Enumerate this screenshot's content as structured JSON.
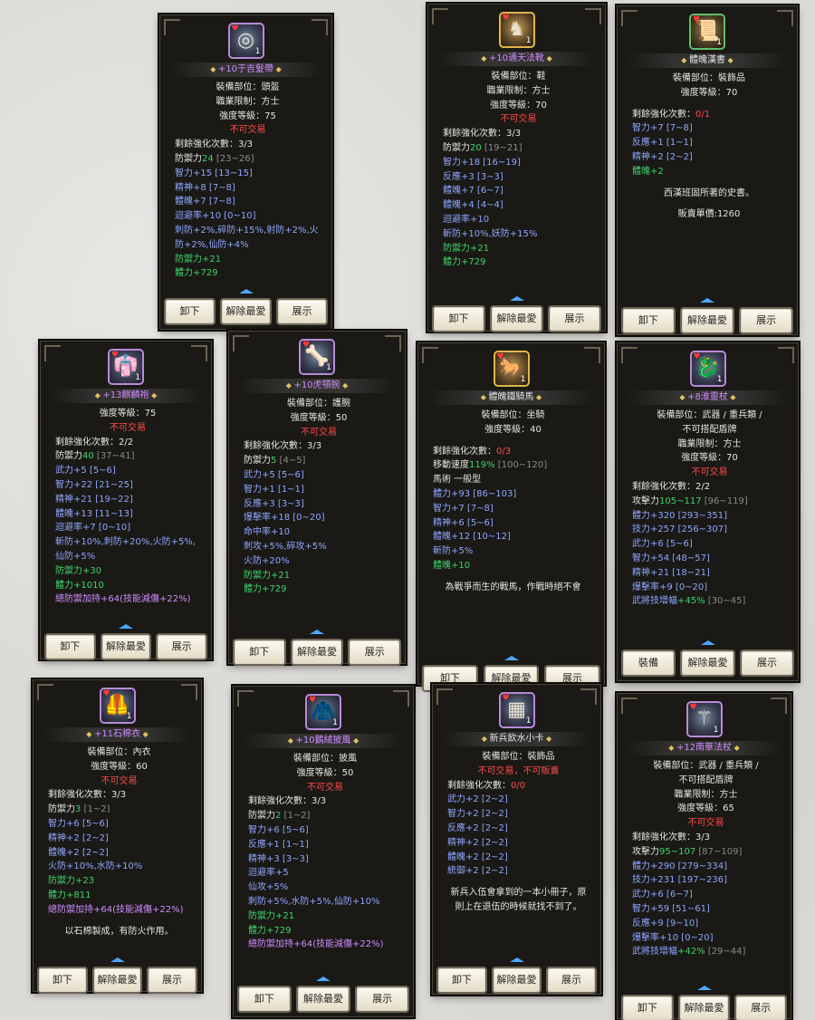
{
  "labels": {
    "slot": "裝備部位：",
    "job": "職業限制：",
    "level": "強度等級："
  },
  "cards": [
    {
      "name": "+10于吉髮帶",
      "name_color": "#d08cff",
      "icon": "head-band-icon",
      "glyph": "◎",
      "lines": [
        {
          "t": "裝備部位：頭盔",
          "c": "wht",
          "a": "c"
        },
        {
          "t": "職業限制：方士",
          "c": "wht",
          "a": "c"
        },
        {
          "t": "強度等級：75",
          "c": "wht",
          "a": "c"
        },
        {
          "t": "不可交易",
          "c": "red",
          "a": "c"
        },
        {
          "t": "剩餘強化次數：3/3",
          "c": "wht"
        },
        {
          "t": "防禦力",
          "v": "24",
          "r": " [23~26]",
          "c": "wht",
          "vc": "grn"
        },
        {
          "t": "智力+15 [13~15]",
          "c": "blu"
        },
        {
          "t": "精神+8 [7~8]",
          "c": "blu"
        },
        {
          "t": "體魄+7 [7~8]",
          "c": "blu"
        },
        {
          "t": "迴避率+10 [0~10]",
          "c": "blu"
        },
        {
          "t": "刺防+2%,碎防+15%,射防+2%,火防+2%,仙防+4%",
          "c": "blu"
        },
        {
          "t": "防禦力+21",
          "c": "grn"
        },
        {
          "t": "體力+729",
          "c": "grn"
        }
      ],
      "buttons": [
        "卸下",
        "解除最愛",
        "展示"
      ]
    },
    {
      "name": "+10通天法靴",
      "name_color": "#d08cff",
      "icon": "boots-icon",
      "glyph": "♞",
      "icls": "gold",
      "lines": [
        {
          "t": "裝備部位：鞋",
          "c": "wht",
          "a": "c"
        },
        {
          "t": "職業限制：方士",
          "c": "wht",
          "a": "c"
        },
        {
          "t": "強度等級：70",
          "c": "wht",
          "a": "c"
        },
        {
          "t": "不可交易",
          "c": "red",
          "a": "c"
        },
        {
          "t": "剩餘強化次數：3/3",
          "c": "wht"
        },
        {
          "t": "防禦力",
          "v": "20",
          "r": " [19~21]",
          "c": "wht",
          "vc": "grn"
        },
        {
          "t": "智力+18 [16~19]",
          "c": "blu"
        },
        {
          "t": "反應+3 [3~3]",
          "c": "blu"
        },
        {
          "t": "體魄+7 [6~7]",
          "c": "blu"
        },
        {
          "t": "體魄+4 [4~4]",
          "c": "blu"
        },
        {
          "t": "迴避率+10",
          "c": "blu"
        },
        {
          "t": "斬防+10%,妖防+15%",
          "c": "blu"
        },
        {
          "t": "防禦力+21",
          "c": "grn"
        },
        {
          "t": "體力+729",
          "c": "grn"
        }
      ],
      "buttons": [
        "卸下",
        "解除最愛",
        "展示"
      ]
    },
    {
      "name": "體魄漢書",
      "name_color": "#e4e4e4",
      "icon": "scroll-icon",
      "glyph": "📜",
      "icls": "green",
      "lines": [
        {
          "t": "裝備部位：裝飾品",
          "c": "wht",
          "a": "c"
        },
        {
          "t": "強度等級：70",
          "c": "wht",
          "a": "c"
        },
        {
          "sp": 1
        },
        {
          "t": "剩餘強化次數：",
          "v": "0/1",
          "c": "wht",
          "vc": "red"
        },
        {
          "t": "智力+7 [7~8]",
          "c": "blu"
        },
        {
          "t": "反應+1 [1~1]",
          "c": "blu"
        },
        {
          "t": "精神+2 [2~2]",
          "c": "blu"
        },
        {
          "t": "體魄+2",
          "c": "grn"
        },
        {
          "sp": 1
        },
        {
          "t": "西漢班固所著的史書。",
          "c": "wht",
          "a": "c"
        },
        {
          "sp": 1
        },
        {
          "t": "販賣單價:1260",
          "c": "wht",
          "a": "c"
        }
      ],
      "buttons": [
        "卸下",
        "解除最愛",
        "展示"
      ]
    },
    {
      "name": "+13麒麟袍",
      "name_color": "#d08cff",
      "icon": "robe-icon",
      "glyph": "👘",
      "lines": [
        {
          "t": "強度等級：75",
          "c": "wht",
          "a": "c"
        },
        {
          "t": "不可交易",
          "c": "red",
          "a": "c"
        },
        {
          "t": "剩餘強化次數：2/2",
          "c": "wht"
        },
        {
          "t": "防禦力",
          "v": "40",
          "r": " [37~41]",
          "c": "wht",
          "vc": "grn"
        },
        {
          "t": "武力+5 [5~6]",
          "c": "blu"
        },
        {
          "t": "智力+22 [21~25]",
          "c": "blu"
        },
        {
          "t": "精神+21 [19~22]",
          "c": "blu"
        },
        {
          "t": "體魄+13 [11~13]",
          "c": "blu"
        },
        {
          "t": "迴避率+7 [0~10]",
          "c": "blu"
        },
        {
          "t": "斬防+10%,刺防+20%,火防+5%,仙防+5%",
          "c": "blu"
        },
        {
          "t": "防禦力+30",
          "c": "grn"
        },
        {
          "t": "體力+1010",
          "c": "grn"
        },
        {
          "t": "總防禦加持+64(技能減傷+22%)",
          "c": "pur"
        }
      ],
      "buttons": [
        "卸下",
        "解除最愛",
        "展示"
      ]
    },
    {
      "name": "+10虎顎腕",
      "name_color": "#d08cff",
      "icon": "bracer-icon",
      "glyph": "🦴",
      "lines": [
        {
          "t": "裝備部位：護腕",
          "c": "wht",
          "a": "c"
        },
        {
          "t": "強度等級：50",
          "c": "wht",
          "a": "c"
        },
        {
          "t": "不可交易",
          "c": "red",
          "a": "c"
        },
        {
          "t": "剩餘強化次數：3/3",
          "c": "wht"
        },
        {
          "t": "防禦力",
          "v": "5",
          "r": " [4~5]",
          "c": "wht",
          "vc": "grn"
        },
        {
          "t": "武力+5 [5~6]",
          "c": "blu"
        },
        {
          "t": "智力+1 [1~1]",
          "c": "blu"
        },
        {
          "t": "反應+3 [3~3]",
          "c": "blu"
        },
        {
          "t": "爆擊率+18 [0~20]",
          "c": "blu"
        },
        {
          "t": "命中率+10",
          "c": "blu"
        },
        {
          "t": "刺攻+5%,碎攻+5%",
          "c": "blu"
        },
        {
          "t": "火防+20%",
          "c": "blu"
        },
        {
          "t": "防禦力+21",
          "c": "grn"
        },
        {
          "t": "體力+729",
          "c": "grn"
        }
      ],
      "buttons": [
        "卸下",
        "解除最愛",
        "展示"
      ]
    },
    {
      "name": "體魄鐵騎馬",
      "name_color": "#e4e4e4",
      "icon": "horse-icon",
      "glyph": "🐎",
      "icls": "gold",
      "lines": [
        {
          "t": "裝備部位：坐騎",
          "c": "wht",
          "a": "c"
        },
        {
          "t": "強度等級：40",
          "c": "wht",
          "a": "c"
        },
        {
          "sp": 1
        },
        {
          "t": "剩餘強化次數：",
          "v": "0/3",
          "c": "wht",
          "vc": "red"
        },
        {
          "t": "移動速度",
          "v": "119%",
          "r": " [100~120]",
          "c": "wht",
          "vc": "grn"
        },
        {
          "t": "馬術 一般型",
          "c": "wht"
        },
        {
          "t": "體力+93 [86~103]",
          "c": "blu"
        },
        {
          "t": "智力+7 [7~8]",
          "c": "blu"
        },
        {
          "t": "精神+6 [5~6]",
          "c": "blu"
        },
        {
          "t": "體魄+12 [10~12]",
          "c": "blu"
        },
        {
          "t": "斬防+5%",
          "c": "blu"
        },
        {
          "t": "體魄+10",
          "c": "grn"
        },
        {
          "sp": 1
        },
        {
          "t": "為戰爭而生的戰馬，作戰時絕不會",
          "c": "wht",
          "a": "c"
        }
      ],
      "buttons": [
        "卸下",
        "解除最愛",
        "展示"
      ]
    },
    {
      "name": "+8淮靈杖",
      "name_color": "#d08cff",
      "icon": "staff-icon",
      "glyph": "🐉",
      "lines": [
        {
          "t": "裝備部位：武器 / 重兵類 /",
          "c": "wht",
          "a": "c"
        },
        {
          "t": "不可搭配盾牌",
          "c": "wht",
          "a": "c"
        },
        {
          "t": "職業限制：方士",
          "c": "wht",
          "a": "c"
        },
        {
          "t": "強度等級：70",
          "c": "wht",
          "a": "c"
        },
        {
          "t": "不可交易",
          "c": "red",
          "a": "c"
        },
        {
          "t": "剩餘強化次數：2/2",
          "c": "wht"
        },
        {
          "t": "攻擊力",
          "v": "105~117",
          "r": " [96~119]",
          "c": "wht",
          "vc": "grn"
        },
        {
          "t": "體力+320 [293~351]",
          "c": "blu"
        },
        {
          "t": "技力+257 [256~307]",
          "c": "blu"
        },
        {
          "t": "武力+6 [5~6]",
          "c": "blu"
        },
        {
          "t": "智力+54 [48~57]",
          "c": "blu"
        },
        {
          "t": "精神+21 [18~21]",
          "c": "blu"
        },
        {
          "t": "爆擊率+9 [0~20]",
          "c": "blu"
        },
        {
          "t": "武將技增幅",
          "v": "+45%",
          "r": " [30~45]",
          "c": "blu",
          "vc": "grn"
        }
      ],
      "buttons": [
        "裝備",
        "解除最愛",
        "展示"
      ]
    },
    {
      "name": "+11石棉衣",
      "name_color": "#d08cff",
      "icon": "vest-icon",
      "glyph": "🦺",
      "lines": [
        {
          "t": "裝備部位：內衣",
          "c": "wht",
          "a": "c"
        },
        {
          "t": "強度等級：60",
          "c": "wht",
          "a": "c"
        },
        {
          "t": "不可交易",
          "c": "red",
          "a": "c"
        },
        {
          "t": "剩餘強化次數：3/3",
          "c": "wht"
        },
        {
          "t": "防禦力",
          "v": "3",
          "r": " [1~2]",
          "c": "wht",
          "vc": "grn"
        },
        {
          "t": "智力+6 [5~6]",
          "c": "blu"
        },
        {
          "t": "精神+2 [2~2]",
          "c": "blu"
        },
        {
          "t": "體魄+2 [2~2]",
          "c": "blu"
        },
        {
          "t": "火防+10%,水防+10%",
          "c": "blu"
        },
        {
          "t": "防禦力+23",
          "c": "grn"
        },
        {
          "t": "體力+811",
          "c": "grn"
        },
        {
          "t": "總防禦加持+64(技能減傷+22%)",
          "c": "pur"
        },
        {
          "sp": 1
        },
        {
          "t": "以石棉製成，有防火作用。",
          "c": "wht",
          "a": "c"
        }
      ],
      "buttons": [
        "卸下",
        "解除最愛",
        "展示"
      ]
    },
    {
      "name": "+10鵝絨披風",
      "name_color": "#d08cff",
      "icon": "cape-icon",
      "glyph": "🧥",
      "lines": [
        {
          "t": "裝備部位：披風",
          "c": "wht",
          "a": "c"
        },
        {
          "t": "強度等級：50",
          "c": "wht",
          "a": "c"
        },
        {
          "t": "不可交易",
          "c": "red",
          "a": "c"
        },
        {
          "t": "剩餘強化次數：3/3",
          "c": "wht"
        },
        {
          "t": "防禦力",
          "v": "2",
          "r": " [1~2]",
          "c": "wht",
          "vc": "grn"
        },
        {
          "t": "智力+6 [5~6]",
          "c": "blu"
        },
        {
          "t": "反應+1 [1~1]",
          "c": "blu"
        },
        {
          "t": "精神+3 [3~3]",
          "c": "blu"
        },
        {
          "t": "迴避率+5",
          "c": "blu"
        },
        {
          "t": "仙攻+5%",
          "c": "blu"
        },
        {
          "t": "刺防+5%,水防+5%,仙防+10%",
          "c": "blu"
        },
        {
          "t": "防禦力+21",
          "c": "grn"
        },
        {
          "t": "體力+729",
          "c": "grn"
        },
        {
          "t": "總防禦加持+64(技能減傷+22%)",
          "c": "pur"
        }
      ],
      "buttons": [
        "卸下",
        "解除最愛",
        "展示"
      ]
    },
    {
      "name": "新兵飲水小卡",
      "name_color": "#e4e4e4",
      "icon": "card-icon",
      "glyph": "▦",
      "lines": [
        {
          "t": "裝備部位：裝飾品",
          "c": "wht",
          "a": "c"
        },
        {
          "t": "不可交易，不可販賣",
          "c": "red",
          "a": "c"
        },
        {
          "t": "剩餘強化次數：",
          "v": "0/0",
          "c": "wht",
          "vc": "red"
        },
        {
          "t": "武力+2 [2~2]",
          "c": "blu"
        },
        {
          "t": "智力+2 [2~2]",
          "c": "blu"
        },
        {
          "t": "反應+2 [2~2]",
          "c": "blu"
        },
        {
          "t": "精神+2 [2~2]",
          "c": "blu"
        },
        {
          "t": "體魄+2 [2~2]",
          "c": "blu"
        },
        {
          "t": "統御+2 [2~2]",
          "c": "blu"
        },
        {
          "sp": 1
        },
        {
          "t": "新兵入伍會拿到的一本小冊子，原",
          "c": "wht",
          "a": "c"
        },
        {
          "t": "則上在退伍的時候就找不到了。",
          "c": "wht",
          "a": "c"
        }
      ],
      "buttons": [
        "卸下",
        "解除最愛",
        "展示"
      ]
    },
    {
      "name": "+12南華法杖",
      "name_color": "#d08cff",
      "icon": "scepter-icon",
      "glyph": "⚚",
      "lines": [
        {
          "t": "裝備部位：武器 / 重兵類 /",
          "c": "wht",
          "a": "c"
        },
        {
          "t": "不可搭配盾牌",
          "c": "wht",
          "a": "c"
        },
        {
          "t": "職業限制：方士",
          "c": "wht",
          "a": "c"
        },
        {
          "t": "強度等級：65",
          "c": "wht",
          "a": "c"
        },
        {
          "t": "不可交易",
          "c": "red",
          "a": "c"
        },
        {
          "t": "剩餘強化次數：3/3",
          "c": "wht"
        },
        {
          "t": "攻擊力",
          "v": "95~107",
          "r": " [87~109]",
          "c": "wht",
          "vc": "grn"
        },
        {
          "t": "體力+290 [279~334]",
          "c": "blu"
        },
        {
          "t": "技力+231 [197~236]",
          "c": "blu"
        },
        {
          "t": "武力+6 [6~7]",
          "c": "blu"
        },
        {
          "t": "智力+59 [51~61]",
          "c": "blu"
        },
        {
          "t": "反應+9 [9~10]",
          "c": "blu"
        },
        {
          "t": "爆擊率+10 [0~20]",
          "c": "blu"
        },
        {
          "t": "武將技增幅",
          "v": "+42%",
          "r": " [29~44]",
          "c": "blu",
          "vc": "grn"
        }
      ],
      "buttons": [
        "卸下",
        "解除最愛",
        "展示"
      ]
    }
  ]
}
